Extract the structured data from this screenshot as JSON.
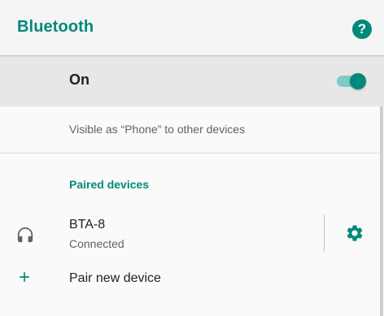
{
  "appbar": {
    "title": "Bluetooth",
    "help_icon": "help-icon",
    "help_glyph": "?"
  },
  "master": {
    "label": "On",
    "switch_on": true
  },
  "visibility_text": "Visible as “Phone” to other devices",
  "paired": {
    "section_title": "Paired devices",
    "devices": [
      {
        "name": "BTA-8",
        "status": "Connected",
        "icon": "headset-icon",
        "settings_icon": "gear-icon"
      }
    ]
  },
  "pair_new": {
    "label": "Pair new device",
    "icon": "plus-icon"
  },
  "colors": {
    "accent": "#00897b",
    "accent_light": "#80cbc4",
    "toolbar_bg": "#f5f5f5",
    "master_bg": "#e7e7e7"
  }
}
